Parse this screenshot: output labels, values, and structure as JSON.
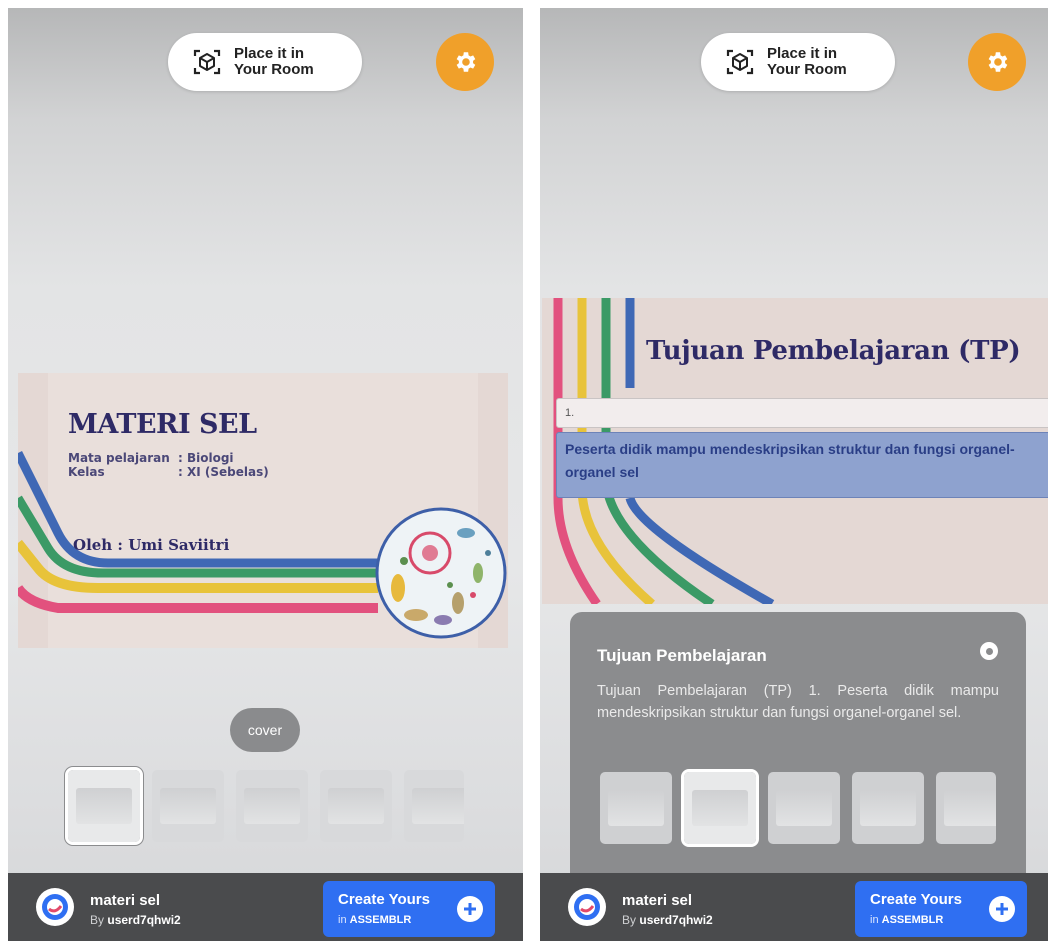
{
  "left_screen": {
    "place_button": {
      "label": "Place it in Your Room"
    },
    "slide": {
      "title": "MATERI SEL",
      "subject_label": "Mata pelajaran",
      "subject_value": ": Biologi",
      "class_label": "Kelas",
      "class_value": ": XI (Sebelas)",
      "author": "Oleh : Umi Saviitri"
    },
    "current_slide_label": "cover",
    "thumbnails": {
      "count": 5,
      "selected_index": 0
    },
    "bottom_bar": {
      "model_name": "materi sel",
      "by_prefix": "By",
      "by_user": "userd7qhwi2",
      "create_line1": "Create Yours",
      "create_in": "in",
      "create_brand": "ASSEMBLR"
    }
  },
  "right_screen": {
    "place_button": {
      "label": "Place it in Your Room"
    },
    "slide": {
      "title": "Tujuan Pembelajaran (TP)",
      "item_number": "1.",
      "item_text": "Peserta didik mampu mendeskripsikan struktur dan fungsi organel-organel sel"
    },
    "info_panel": {
      "title": "Tujuan Pembelajaran",
      "description": "Tujuan Pembelajaran (TP) 1. Peserta didik mampu mendeskripsikan struktur dan fungsi organel-organel sel."
    },
    "thumbnails": {
      "count": 5,
      "selected_index": 1
    },
    "bottom_bar": {
      "model_name": "materi sel",
      "by_prefix": "By",
      "by_user": "userd7qhwi2",
      "create_line1": "Create Yours",
      "create_in": "in",
      "create_brand": "ASSEMBLR"
    }
  },
  "colors": {
    "accent_orange": "#f0a02a",
    "create_blue": "#2f6ff2",
    "slide_navy": "#2e2a66",
    "stripe_blue": "#3f68b5",
    "stripe_green": "#3b9a66",
    "stripe_yellow": "#e8c33a",
    "stripe_pink": "#e2517e"
  },
  "icons": [
    "ar-cube-icon",
    "gear-icon",
    "plus-icon",
    "close-icon",
    "assemblr-logo-icon"
  ]
}
